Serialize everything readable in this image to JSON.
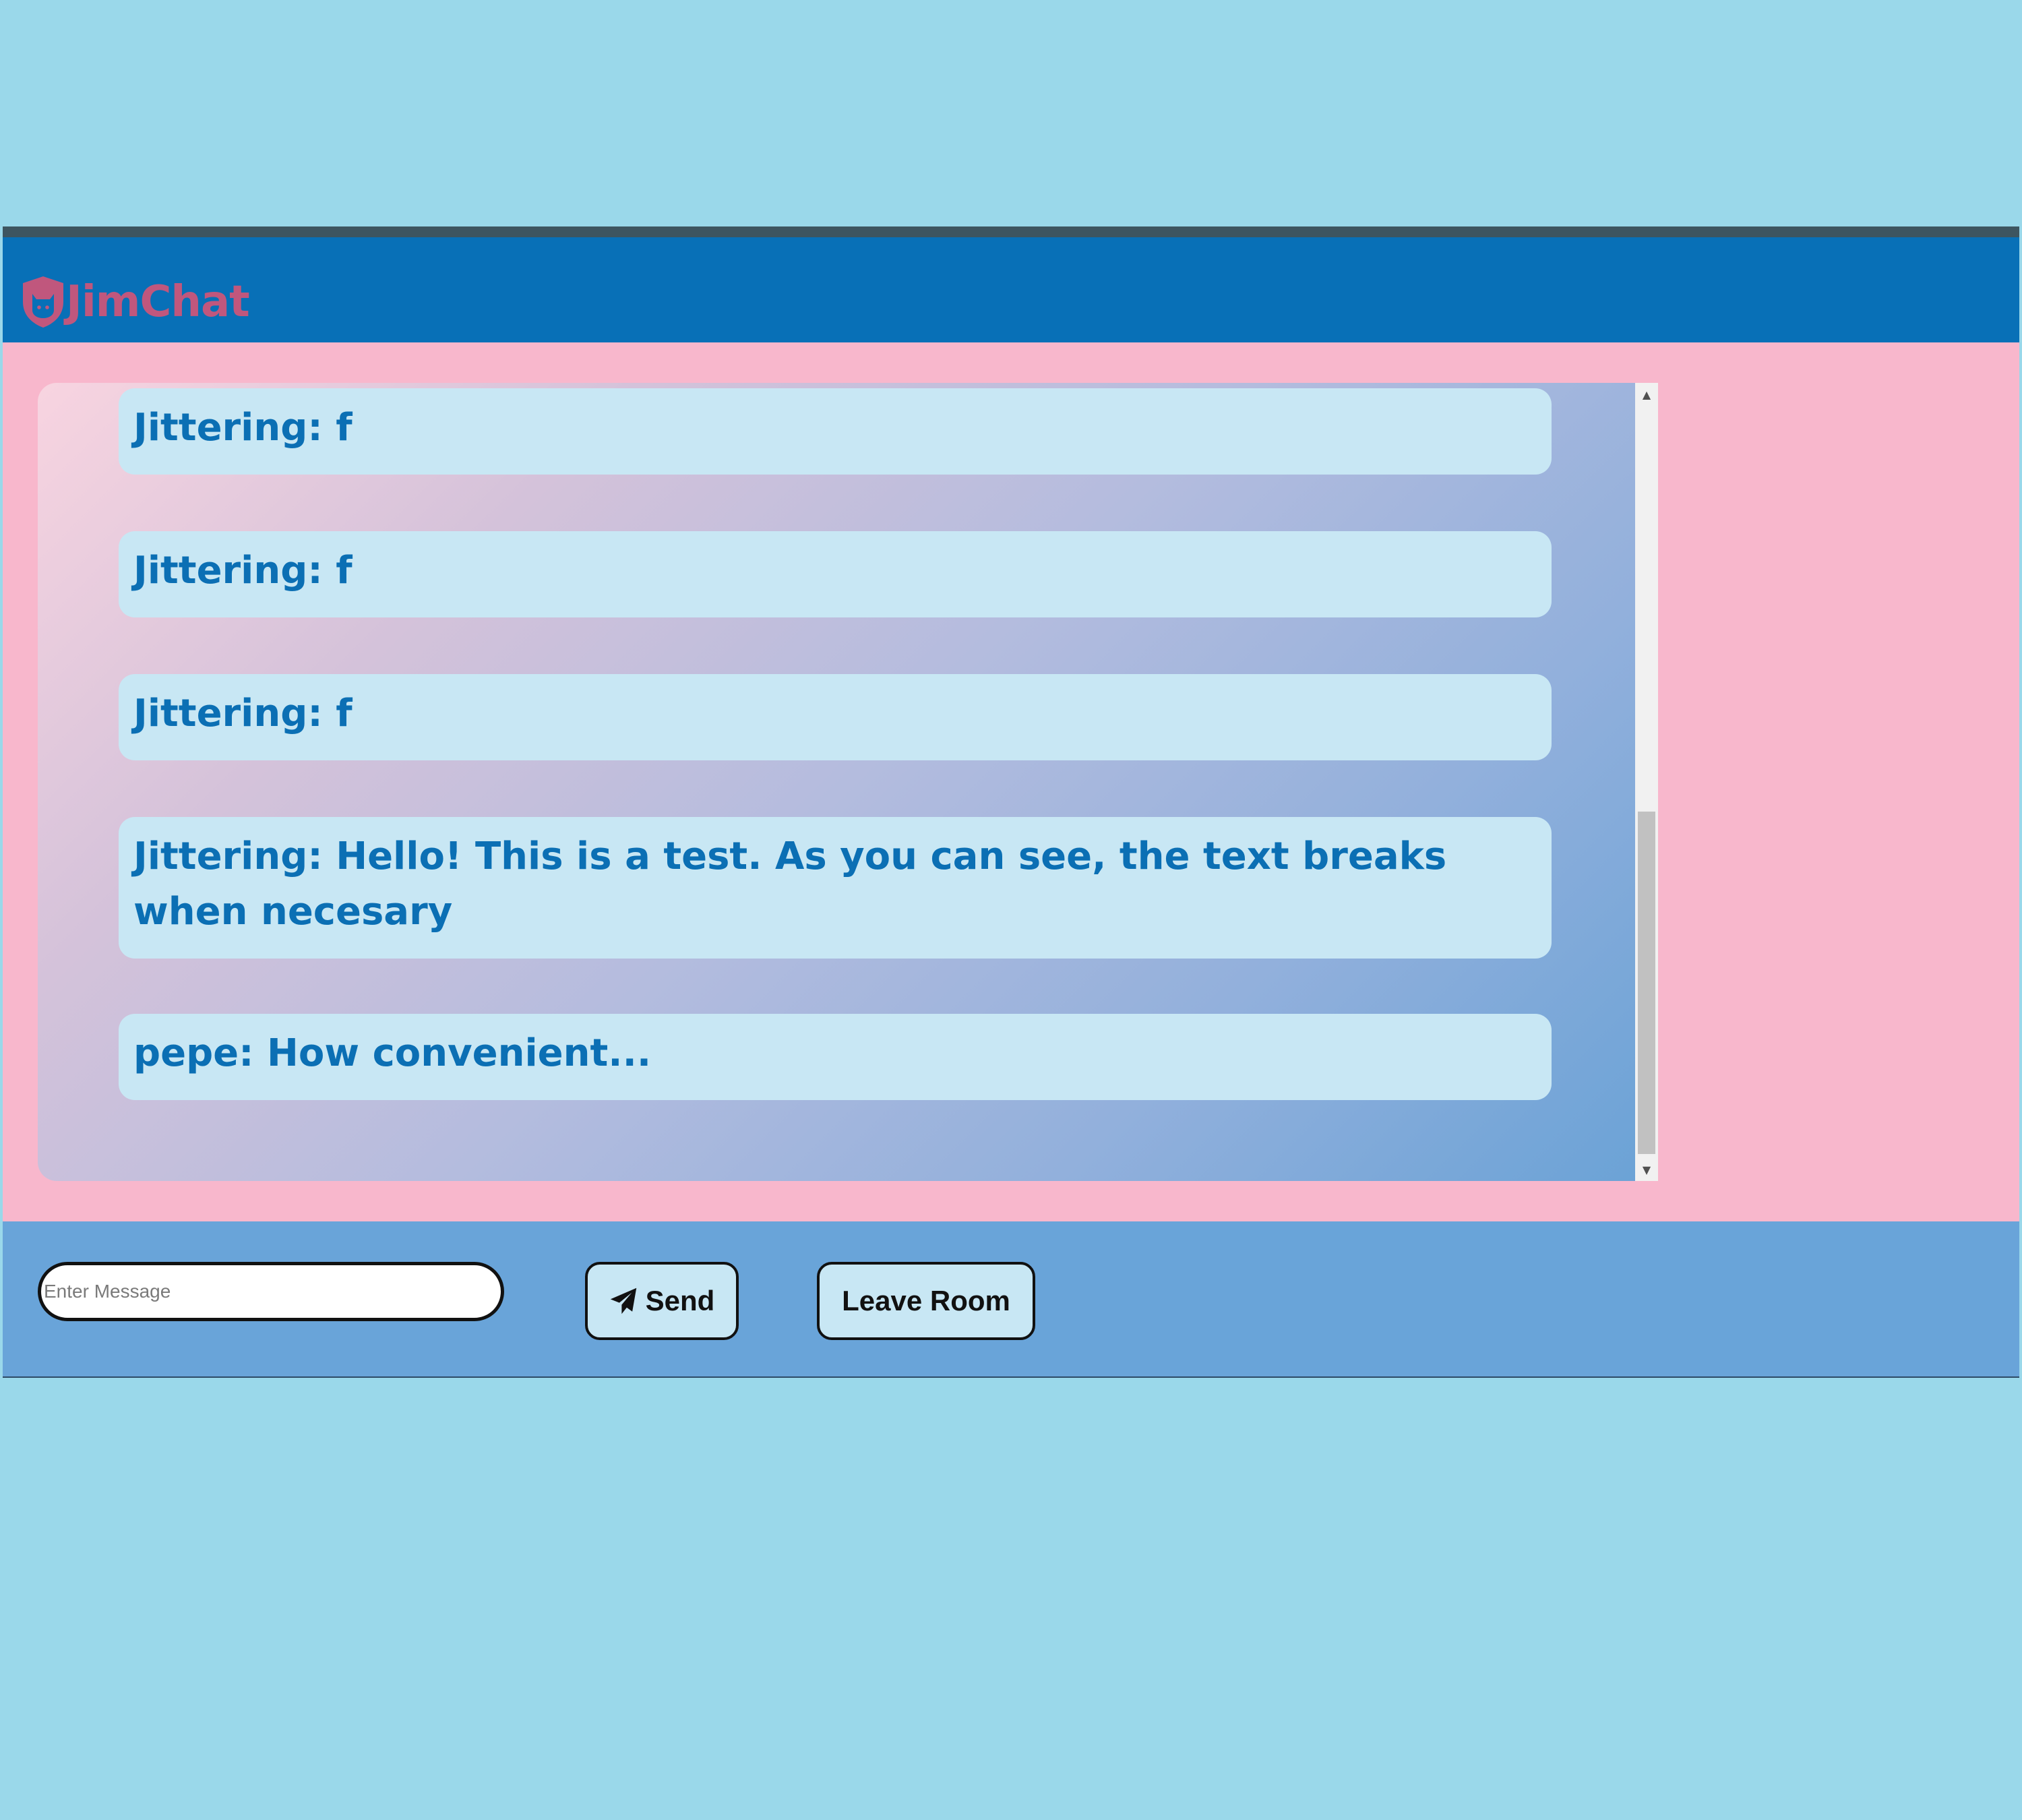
{
  "app": {
    "name": "JimChat"
  },
  "messages": [
    {
      "text": "Jittering: f"
    },
    {
      "text": "Jittering: f"
    },
    {
      "text": "Jittering: f"
    },
    {
      "text": "Jittering: Hello! This is a test. As you can see, the text breaks when necesary"
    },
    {
      "text": "pepe: How convenient..."
    }
  ],
  "composer": {
    "placeholder": "Enter Message",
    "value": ""
  },
  "buttons": {
    "send_label": "Send",
    "leave_label": "Leave Room"
  },
  "icons": {
    "logo": "cat-shield-icon",
    "send": "paper-plane-icon",
    "scroll_up": "arrow-up-icon",
    "scroll_down": "arrow-down-icon"
  },
  "colors": {
    "page_background": "#9ad8ea",
    "header": "#0870b7",
    "logo": "#c0577d",
    "main_background": "#f8b7cc",
    "message_bubble": "#c8e7f4",
    "message_text": "#0b6fb4",
    "footer": "#69a4d9"
  }
}
